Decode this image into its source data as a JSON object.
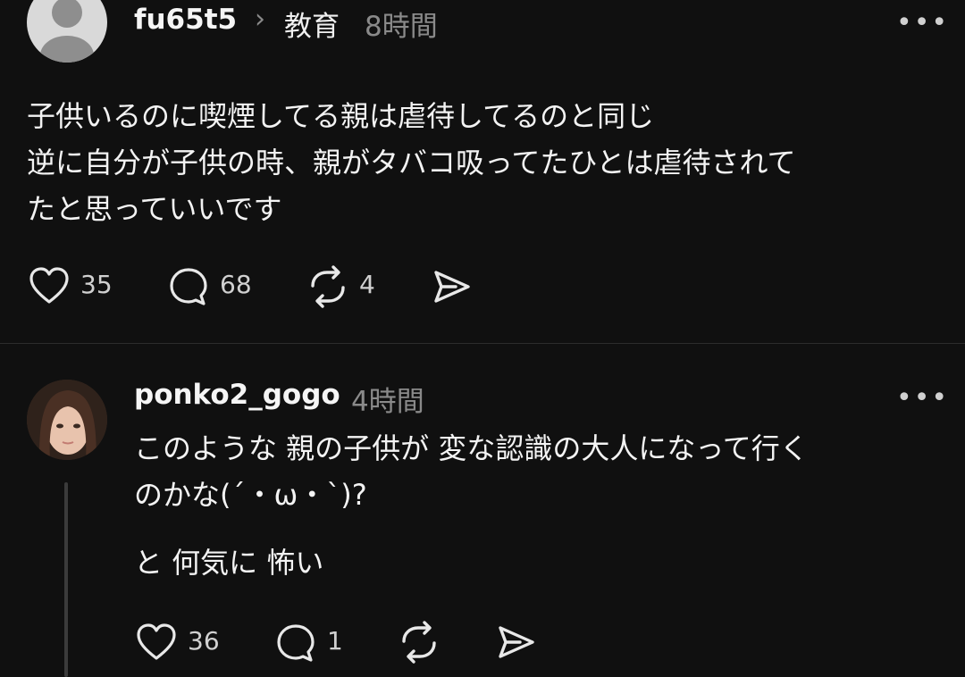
{
  "post": {
    "username": "fu65t5",
    "breadcrumb_sep": "›",
    "topic": "教育",
    "time": "8時間",
    "more": "•••",
    "lines": [
      "子供いるのに喫煙してる親は虐待してるのと同じ",
      "逆に自分が子供の時、親がタバコ吸ってたひとは虐待されて",
      "たと思っていいです"
    ],
    "actions": {
      "likes": "35",
      "replies": "68",
      "reposts": "4"
    }
  },
  "reply": {
    "username": "ponko2_gogo",
    "time": "4時間",
    "more": "•••",
    "lines": [
      "このような 親の子供が 変な認識の大人になって行く",
      "のかな(´・ω・`)?"
    ],
    "line2": "と 何気に 怖い",
    "actions": {
      "likes": "36",
      "replies": "1"
    }
  },
  "colors": {
    "background": "#101010",
    "text": "#f3f3f3",
    "muted": "#8a8a8a",
    "divider": "#2c2c2c"
  },
  "icons": [
    "person-icon",
    "chevron-right-icon",
    "more-icon",
    "heart-icon",
    "comment-icon",
    "repost-icon",
    "share-icon"
  ]
}
